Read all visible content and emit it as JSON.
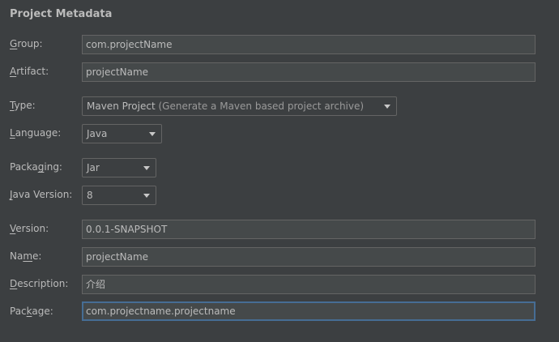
{
  "section_title": "Project Metadata",
  "fields": {
    "group": {
      "label_mn": "G",
      "label_rest": "roup:",
      "value": "com.projectName"
    },
    "artifact": {
      "label_mn": "A",
      "label_rest": "rtifact:",
      "value": "projectName"
    },
    "type": {
      "label_pre": "",
      "label_mn": "T",
      "label_rest": "ype:",
      "value": "Maven Project",
      "hint": "(Generate a Maven based project archive)"
    },
    "language": {
      "label_pre": "",
      "label_mn": "L",
      "label_rest": "anguage:",
      "value": "Java"
    },
    "packaging": {
      "label_pre": "Packa",
      "label_mn": "g",
      "label_rest": "ing:",
      "value": "Jar"
    },
    "java_version": {
      "label_pre": "",
      "label_mn": "J",
      "label_rest": "ava Version:",
      "value": "8"
    },
    "version": {
      "label_pre": "",
      "label_mn": "V",
      "label_rest": "ersion:",
      "value": "0.0.1-SNAPSHOT"
    },
    "name": {
      "label_pre": "Na",
      "label_mn": "m",
      "label_rest": "e:",
      "value": "projectName"
    },
    "description": {
      "label_pre": "",
      "label_mn": "D",
      "label_rest": "escription:",
      "value": "介绍"
    },
    "package": {
      "label_pre": "Pac",
      "label_mn": "k",
      "label_rest": "age:",
      "value": "com.projectname.projectname"
    }
  },
  "colors": {
    "background": "#3c3f41",
    "field_bg": "#45494a",
    "border": "#646464",
    "focus_border": "#466d94",
    "text": "#bbbbbb"
  },
  "icons": {
    "dropdown": "chevron-down-icon"
  }
}
